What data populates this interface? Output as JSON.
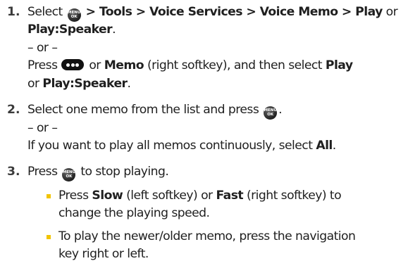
{
  "steps": [
    {
      "number": "1.",
      "select": "Select",
      "path": "> Tools > Voice Services > Voice Memo > Play",
      "or": "or",
      "play_speaker": "Play:Speaker",
      "period": ".",
      "or_separator": "– or –",
      "press": "Press",
      "or2": "or",
      "memo": "Memo",
      "right_softkey_then": "(right softkey), and then select",
      "play": "Play",
      "or3": "or",
      "play_speaker2": "Play:Speaker",
      "period2": "."
    },
    {
      "number": "2.",
      "text": "Select one memo from the list and press",
      "period": ".",
      "or_separator": "– or –",
      "alt_text": "If you want to play all memos continuously, select",
      "all": "All",
      "period2": "."
    },
    {
      "number": "3.",
      "press": "Press",
      "to_stop": "to stop playing."
    }
  ],
  "bullets": [
    {
      "press": "Press",
      "slow": "Slow",
      "left_or": "(left softkey) or",
      "fast": "Fast",
      "right_to": "(right softkey) to",
      "line2": "change the playing speed."
    },
    {
      "line1": "To play the newer/older memo, press the navigation",
      "line2": "key right or left."
    }
  ],
  "menu_key": {
    "top": "MENU",
    "bottom": "OK"
  },
  "colors": {
    "text": "#1f1f1f",
    "number": "#3b3b3b",
    "bullet": "#f2c400",
    "key": "#111111"
  }
}
